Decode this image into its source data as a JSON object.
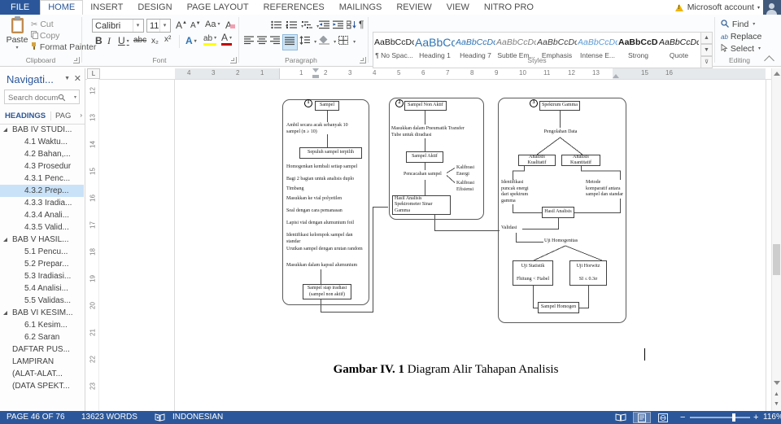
{
  "window": {
    "account_label": "Microsoft account"
  },
  "tabs": {
    "items": [
      "FILE",
      "HOME",
      "INSERT",
      "DESIGN",
      "PAGE LAYOUT",
      "REFERENCES",
      "MAILINGS",
      "REVIEW",
      "VIEW",
      "NITRO PRO"
    ],
    "active": "HOME"
  },
  "ribbon": {
    "clipboard": {
      "label": "Clipboard",
      "paste": "Paste",
      "cut": "Cut",
      "copy": "Copy",
      "format_painter": "Format Painter"
    },
    "font": {
      "label": "Font",
      "family": "Calibri",
      "size": "11",
      "bold": "B",
      "italic": "I",
      "underline": "U",
      "strike": "abc",
      "subscript": "x₂",
      "superscript": "x²",
      "grow": "A",
      "shrink": "A",
      "case": "Aa",
      "clear": "A",
      "effects": "A",
      "highlight": "ab",
      "color": "A"
    },
    "paragraph": {
      "label": "Paragraph",
      "pilcrow": "¶"
    },
    "styles": {
      "label": "Styles",
      "items": [
        {
          "sample": "AaBbCcDc",
          "name": "¶ No Spac..."
        },
        {
          "sample": "AaBbCc",
          "name": "Heading 1"
        },
        {
          "sample": "AaBbCcDc",
          "name": "Heading 7"
        },
        {
          "sample": "AaBbCcDc",
          "name": "Subtle Em..."
        },
        {
          "sample": "AaBbCcDc",
          "name": "Emphasis"
        },
        {
          "sample": "AaBbCcDc",
          "name": "Intense E..."
        },
        {
          "sample": "AaBbCcDc",
          "name": "Strong"
        },
        {
          "sample": "AaBbCcDc",
          "name": "Quote"
        }
      ]
    },
    "editing": {
      "label": "Editing",
      "find": "Find",
      "replace": "Replace",
      "select": "Select"
    }
  },
  "navigation": {
    "title": "Navigati...",
    "search_placeholder": "Search docume",
    "tab_headings": "HEADINGS",
    "tab_pages": "PAG",
    "items": [
      {
        "label": "BAB IV STUDI...",
        "level": 0,
        "expand": true
      },
      {
        "label": "4.1 Waktu...",
        "level": 1
      },
      {
        "label": "4.2 Bahan,...",
        "level": 1
      },
      {
        "label": "4.3 Prosedur",
        "level": 1
      },
      {
        "label": "4.3.1 Penc...",
        "level": 1
      },
      {
        "label": "4.3.2 Prep...",
        "level": 1,
        "selected": true
      },
      {
        "label": "4.3.3 Iradia...",
        "level": 1
      },
      {
        "label": "4.3.4 Anali...",
        "level": 1
      },
      {
        "label": "4.3.5 Valid...",
        "level": 1
      },
      {
        "label": "BAB V HASIL...",
        "level": 0,
        "expand": true
      },
      {
        "label": "5.1 Pencu...",
        "level": 1
      },
      {
        "label": "5.2 Prepar...",
        "level": 1
      },
      {
        "label": "5.3 Iradiasi...",
        "level": 1
      },
      {
        "label": "5.4 Analisi...",
        "level": 1
      },
      {
        "label": "5.5 Validas...",
        "level": 1
      },
      {
        "label": "BAB VI KESIM...",
        "level": 0,
        "expand": true
      },
      {
        "label": "6.1 Kesim...",
        "level": 1
      },
      {
        "label": "6.2 Saran",
        "level": 1
      },
      {
        "label": "DAFTAR PUS...",
        "level": 0
      },
      {
        "label": "LAMPIRAN",
        "level": 0
      },
      {
        "label": "(ALAT-ALAT...",
        "level": 0
      },
      {
        "label": "(DATA SPEKT...",
        "level": 0
      }
    ]
  },
  "ruler": {
    "h_labels": [
      "4",
      "3",
      "2",
      "1",
      "1",
      "2",
      "3",
      "4",
      "5",
      "6",
      "7",
      "8",
      "9",
      "10",
      "11",
      "12",
      "13",
      "15",
      "16"
    ],
    "v_labels": [
      "12",
      "13",
      "14",
      "15",
      "16",
      "17",
      "18",
      "19",
      "20",
      "21",
      "22",
      "23"
    ]
  },
  "document": {
    "caption": {
      "bold": "Gambar IV. 1",
      "rest": " Diagram Alir Tahapan Analisis"
    },
    "diagram": {
      "col1": {
        "badge": "1",
        "box_sampel": "Sampel",
        "text_ambil": "Ambil secara acak sebanyak 10 sampel (n ≥ 10)",
        "box_sepuluh": "Sepuluh sampel terpilih",
        "steps": [
          "Homogenkan kembali setiap sampel",
          "Bagi 2 bagian untuk analisis duplo",
          "Timbang",
          "Masukkan ke vial polyetilen",
          "Seal dengan cara pemanasan",
          "Lapisi vial dengan alumunium foil",
          "Identifikasi kelompok sampel dan standar",
          "Urutkan sampel dengan urutan random",
          "Masukkan dalam kapsul alumunium"
        ],
        "box_siap": "Sampel siap iradiasi (sampel non aktif)"
      },
      "col2": {
        "badge": "2",
        "box_non_aktif": "Sampel Non Aktif",
        "text_pneumatik": "Masukkan dalam Pneumatik Transfer Tube untuk diradiasi",
        "box_aktif": "Sampel Aktif",
        "text_pencacahan": "Pencacahan sampel",
        "label_kal_energi": "Kalibrasi Energi",
        "label_kal_efisiensi": "Kalibrasi Efisiensi",
        "box_hasil": "Hasil Analisis Spektrometer Sinar Gamma"
      },
      "col3": {
        "badge": "3",
        "box_spektrum": "Spektrum Gamma",
        "text_pengolahan": "Pengolahan Data",
        "box_kualitatif": "Analisis Kualitatif",
        "box_kuantitatif": "Analisis Kuantitatif",
        "text_identifikasi": "Identifikasi puncak energi dari spektrum gamma",
        "text_metode": "Metode komparatif antara sampel dan standar",
        "box_hasil_analisis": "Hasil Analisis",
        "text_validasi": "Validasi",
        "text_uji_homogenitas": "Uji Homogenitas",
        "box_uji_statistik_title": "Uji Statistik",
        "box_uji_statistik_formula": "Fhitung < Ftabel",
        "box_uji_horwitz_title": "Uji Horwitz",
        "box_uji_horwitz_formula": "SI ≤ 0.3σ",
        "box_sampel_homogen": "Sampel Homogen"
      }
    }
  },
  "status": {
    "page": "PAGE 46 OF 76",
    "words": "13623 WORDS",
    "language": "INDONESIAN",
    "zoom_minus": "−",
    "zoom_plus": "+",
    "zoom_value": "116%"
  }
}
